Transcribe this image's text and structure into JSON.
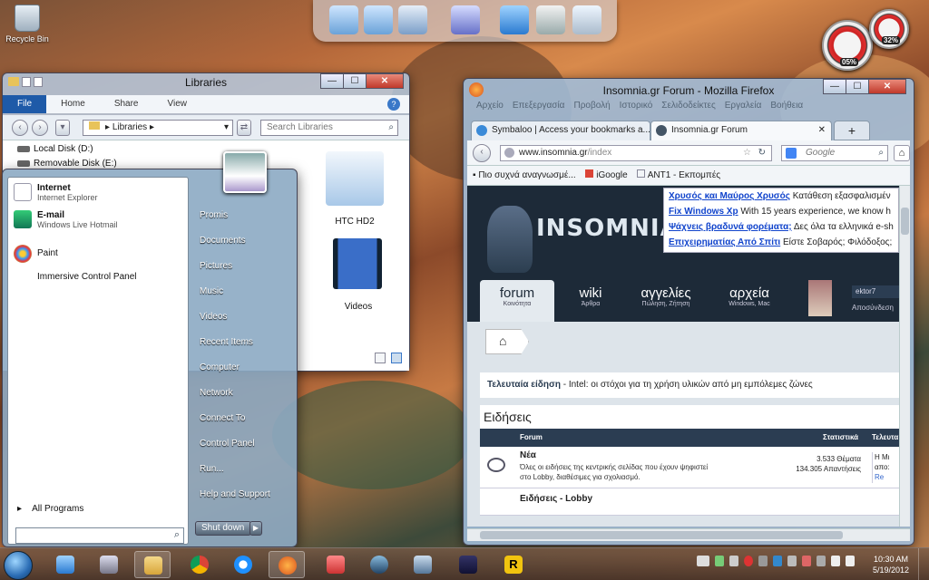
{
  "desktop": {
    "recycle_bin_label": "Recycle Bin"
  },
  "gauges": {
    "cpu": "05%",
    "mem": "32%"
  },
  "explorer": {
    "title": "Libraries",
    "ribbon_tabs": [
      "File",
      "Home",
      "Share",
      "View"
    ],
    "address": [
      "Libraries"
    ],
    "search_placeholder": "Search Libraries",
    "nav_items": [
      "Local Disk (D:)",
      "Removable Disk (E:)"
    ],
    "libraries": [
      "HTC HD2",
      "Videos"
    ]
  },
  "start_menu": {
    "pinned": [
      {
        "title": "Internet",
        "sub": "Internet Explorer"
      },
      {
        "title": "E-mail",
        "sub": "Windows Live Hotmail"
      },
      {
        "title": "Paint",
        "sub": ""
      },
      {
        "title": "Immersive Control Panel",
        "sub": ""
      }
    ],
    "all_programs": "All Programs",
    "right_items": [
      "Promis",
      "Documents",
      "Pictures",
      "Music",
      "Videos",
      "Recent Items",
      "Computer",
      "Network",
      "Connect To",
      "Control Panel",
      "Run...",
      "Help and Support"
    ],
    "shutdown": "Shut down"
  },
  "firefox": {
    "title": "Insomnia.gr Forum - Mozilla Firefox",
    "menu": [
      "Αρχείο",
      "Επεξεργασία",
      "Προβολή",
      "Ιστορικό",
      "Σελιδοδείκτες",
      "Εργαλεία",
      "Βοήθεια"
    ],
    "tabs": [
      {
        "label": "Symbaloo | Access your bookmarks a..."
      },
      {
        "label": "Insomnia.gr Forum"
      }
    ],
    "url_host": "www.insomnia.gr",
    "url_path": "/index",
    "search_placeholder": "Google",
    "bookmarks": [
      "Πιο συχνά αναγνωσμέ...",
      "iGoogle",
      "ANT1 - Εκπομπές"
    ]
  },
  "site": {
    "logo": "INSOMNIA",
    "ads": [
      {
        "link": "Χρυσός και Μαύρος Χρυσός",
        "text": "Κατάθεση εξασφαλισμέν"
      },
      {
        "link": "Fix Windows Xp",
        "text": "With 15 years experience, we know h"
      },
      {
        "link": "Ψάχνεις βραδυνά φορέματα;",
        "text": "Δες όλα τα ελληνικά e-sh"
      },
      {
        "link": "Επιχειρηματίας Από Σπίτι",
        "text": "Είστε Σοβαρός; Φιλόδοξος;"
      }
    ],
    "nav": [
      {
        "main": "forum",
        "sub": "Κοινότητα"
      },
      {
        "main": "wiki",
        "sub": "Άρθρα"
      },
      {
        "main": "αγγελίες",
        "sub": "Πώληση, Ζήτηση"
      },
      {
        "main": "αρχεία",
        "sub": "Windows, Mac"
      }
    ],
    "user": {
      "name": "ektor7",
      "logout": "Αποσύνδεση"
    },
    "latest_label": "Τελευταία είδηση",
    "latest_text": "Intel: οι στόχοι για τη χρήση υλικών από μη εμπόλεμες ζώνες",
    "section_title": "Ειδήσεις",
    "table_headers": {
      "forum": "Forum",
      "stats": "Στατιστικά",
      "last": "Τελευτα"
    },
    "rows": [
      {
        "title": "Νέα",
        "desc1": "Όλες οι ειδήσεις της κεντρικής σελίδας που έχουν ψηφιστεί",
        "desc2": "στο Lobby, διαθέσιμες για σχολιασμό.",
        "stat1": "3.533 Θέματα",
        "stat2": "134.305 Απαντήσεις",
        "last1": "Η Μι",
        "last2": "απο:",
        "last3": "Re"
      },
      {
        "title": "Ειδήσεις - Lobby",
        "desc1": "",
        "desc2": "",
        "stat1": "",
        "stat2": "",
        "last1": "",
        "last2": "",
        "last3": ""
      }
    ]
  },
  "taskbar": {
    "time": "10:30 AM",
    "date": "5/19/2012"
  }
}
